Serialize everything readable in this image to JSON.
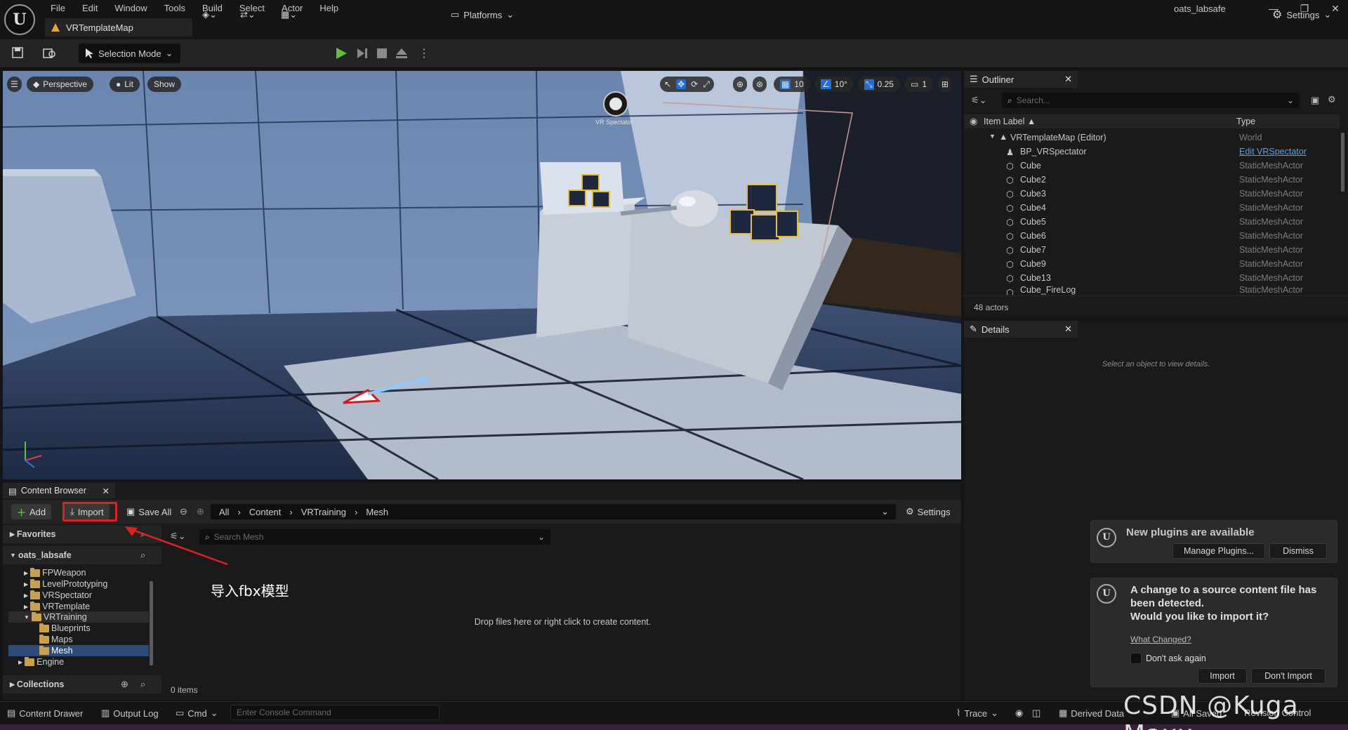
{
  "menu": {
    "items": [
      "File",
      "Edit",
      "Window",
      "Tools",
      "Build",
      "Select",
      "Actor",
      "Help"
    ]
  },
  "tab": {
    "map_name": "VRTemplateMap"
  },
  "user": "oats_labsafe",
  "toolbar": {
    "selection_mode": "Selection Mode",
    "platforms": "Platforms",
    "settings": "Settings"
  },
  "viewport": {
    "perspective": "Perspective",
    "lit": "Lit",
    "show": "Show",
    "grid_snap": "10",
    "angle_snap": "10°",
    "scale_snap": "0.25",
    "camera_speed": "1",
    "spectator_label": "VR Spectator"
  },
  "outliner": {
    "title": "Outliner",
    "search_placeholder": "Search...",
    "col_label": "Item Label ▲",
    "col_type": "Type",
    "rows": [
      {
        "label": "VRTemplateMap (Editor)",
        "type": "World"
      },
      {
        "label": "BP_VRSpectator",
        "type": "Edit VRSpectator"
      },
      {
        "label": "Cube",
        "type": "StaticMeshActor"
      },
      {
        "label": "Cube2",
        "type": "StaticMeshActor"
      },
      {
        "label": "Cube3",
        "type": "StaticMeshActor"
      },
      {
        "label": "Cube4",
        "type": "StaticMeshActor"
      },
      {
        "label": "Cube5",
        "type": "StaticMeshActor"
      },
      {
        "label": "Cube6",
        "type": "StaticMeshActor"
      },
      {
        "label": "Cube7",
        "type": "StaticMeshActor"
      },
      {
        "label": "Cube9",
        "type": "StaticMeshActor"
      },
      {
        "label": "Cube13",
        "type": "StaticMeshActor"
      },
      {
        "label": "Cube_FireLog",
        "type": "StaticMeshActor"
      }
    ],
    "actor_count": "48 actors"
  },
  "details": {
    "title": "Details",
    "empty_message": "Select an object to view details."
  },
  "content_browser": {
    "title": "Content Browser",
    "add": "Add",
    "import": "Import",
    "save_all": "Save All",
    "breadcrumbs": [
      "All",
      "Content",
      "VRTraining",
      "Mesh"
    ],
    "settings": "Settings",
    "favorites": "Favorites",
    "project": "oats_labsafe",
    "folders": [
      "FPWeapon",
      "LevelPrototyping",
      "VRSpectator",
      "VRTemplate",
      "VRTraining",
      "Blueprints",
      "Maps",
      "Mesh",
      "Engine"
    ],
    "collections": "Collections",
    "search_placeholder": "Search Mesh",
    "drop_hint": "Drop files here or right click to create content.",
    "item_count": "0 items",
    "annotation": "导入fbx模型"
  },
  "notifications": {
    "plugins": {
      "title": "New plugins are available",
      "manage": "Manage Plugins...",
      "dismiss": "Dismiss"
    },
    "reimport": {
      "line1": "A change to a source content file has",
      "line2": "been detected.",
      "line3": "Would you like to import it?",
      "what_changed": "What Changed?",
      "dont_ask": "Don't ask again",
      "import": "Import",
      "dont_import": "Don't Import"
    }
  },
  "statusbar": {
    "content_drawer": "Content Drawer",
    "output_log": "Output Log",
    "cmd": "Cmd",
    "console_placeholder": "Enter Console Command",
    "trace": "Trace",
    "derived_data": "Derived Data",
    "all_saved": "All Saved",
    "revision_control": "Revision Control"
  },
  "watermark": "CSDN @Kuga Maxx",
  "colors": {
    "accent_blue": "#1f6fd6",
    "play_green": "#5fbf3f",
    "highlight_red": "#e02020",
    "folder": "#c7a050"
  }
}
